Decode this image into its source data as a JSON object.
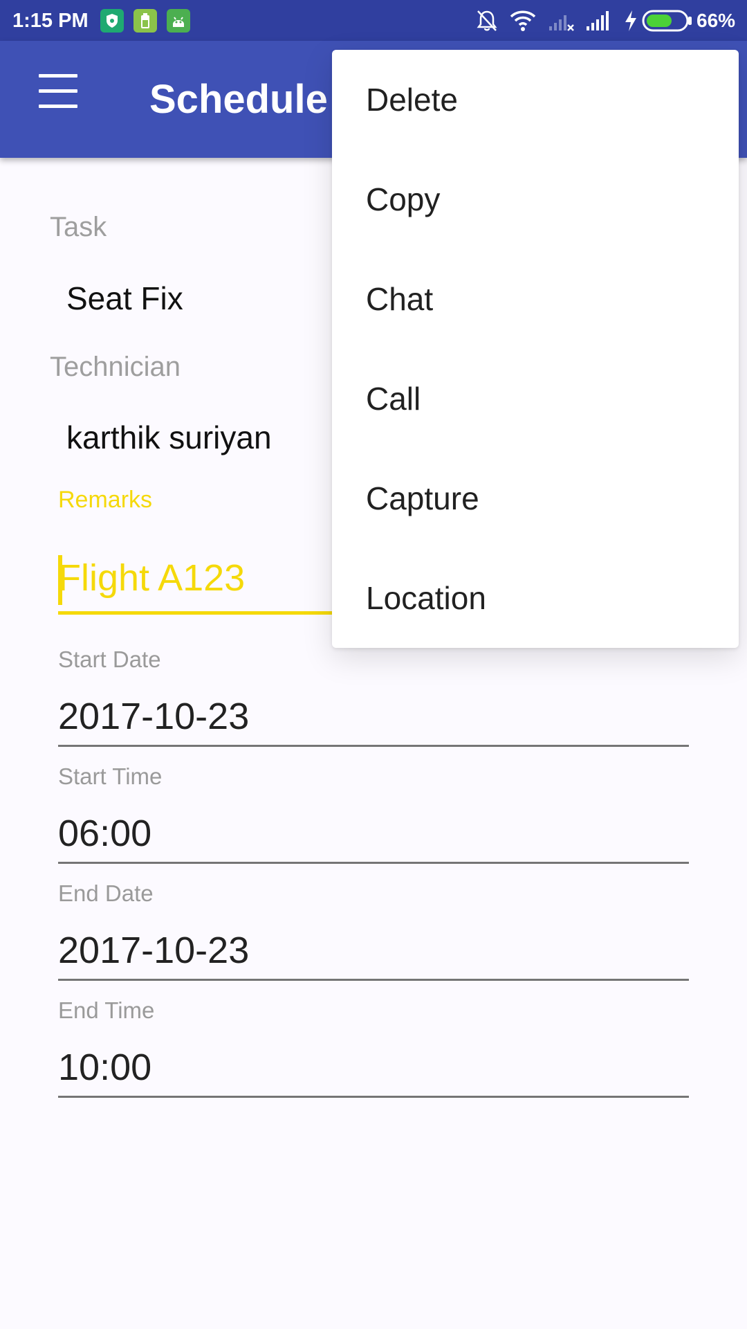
{
  "status_bar": {
    "time": "1:15 PM",
    "battery_percent": "66%",
    "battery_level": 0.66,
    "notification_icons": [
      "shield-notification-icon",
      "battery-notification-icon",
      "android-notification-icon"
    ],
    "system_icons": [
      "bell-muted-icon",
      "wifi-icon",
      "signal-no-service-icon",
      "signal-icon",
      "charging-icon",
      "battery-icon"
    ]
  },
  "app_bar": {
    "title": "Schedule",
    "menu_icon": "hamburger-menu-icon",
    "color": "#3f51b5"
  },
  "form": {
    "task_label": "Task",
    "task_value": "Seat Fix",
    "technician_label": "Technician",
    "technician_value": "karthik suriyan",
    "remarks_label": "Remarks",
    "remarks_value": "Flight A123",
    "start_date_label": "Start Date",
    "start_date_value": "2017-10-23",
    "start_time_label": "Start Time",
    "start_time_value": "06:00",
    "end_date_label": "End Date",
    "end_date_value": "2017-10-23",
    "end_time_label": "End Time",
    "end_time_value": "10:00",
    "accent_color": "#f5d90a"
  },
  "popup_menu": {
    "items": [
      {
        "label": "Delete"
      },
      {
        "label": "Copy"
      },
      {
        "label": "Chat"
      },
      {
        "label": "Call"
      },
      {
        "label": "Capture"
      },
      {
        "label": "Location"
      }
    ]
  }
}
